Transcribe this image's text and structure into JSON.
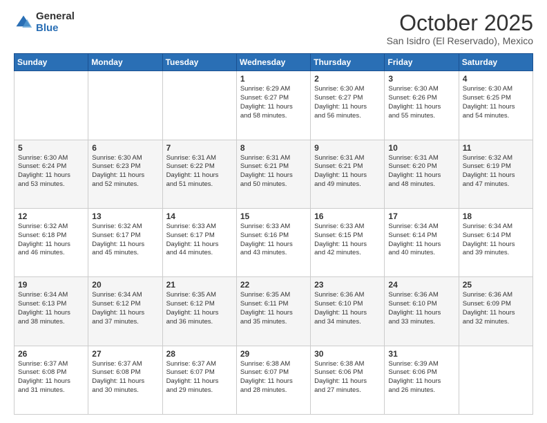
{
  "logo": {
    "general": "General",
    "blue": "Blue"
  },
  "header": {
    "month": "October 2025",
    "location": "San Isidro (El Reservado), Mexico"
  },
  "days_of_week": [
    "Sunday",
    "Monday",
    "Tuesday",
    "Wednesday",
    "Thursday",
    "Friday",
    "Saturday"
  ],
  "weeks": [
    [
      {
        "num": "",
        "info": ""
      },
      {
        "num": "",
        "info": ""
      },
      {
        "num": "",
        "info": ""
      },
      {
        "num": "1",
        "info": "Sunrise: 6:29 AM\nSunset: 6:27 PM\nDaylight: 11 hours\nand 58 minutes."
      },
      {
        "num": "2",
        "info": "Sunrise: 6:30 AM\nSunset: 6:27 PM\nDaylight: 11 hours\nand 56 minutes."
      },
      {
        "num": "3",
        "info": "Sunrise: 6:30 AM\nSunset: 6:26 PM\nDaylight: 11 hours\nand 55 minutes."
      },
      {
        "num": "4",
        "info": "Sunrise: 6:30 AM\nSunset: 6:25 PM\nDaylight: 11 hours\nand 54 minutes."
      }
    ],
    [
      {
        "num": "5",
        "info": "Sunrise: 6:30 AM\nSunset: 6:24 PM\nDaylight: 11 hours\nand 53 minutes."
      },
      {
        "num": "6",
        "info": "Sunrise: 6:30 AM\nSunset: 6:23 PM\nDaylight: 11 hours\nand 52 minutes."
      },
      {
        "num": "7",
        "info": "Sunrise: 6:31 AM\nSunset: 6:22 PM\nDaylight: 11 hours\nand 51 minutes."
      },
      {
        "num": "8",
        "info": "Sunrise: 6:31 AM\nSunset: 6:21 PM\nDaylight: 11 hours\nand 50 minutes."
      },
      {
        "num": "9",
        "info": "Sunrise: 6:31 AM\nSunset: 6:21 PM\nDaylight: 11 hours\nand 49 minutes."
      },
      {
        "num": "10",
        "info": "Sunrise: 6:31 AM\nSunset: 6:20 PM\nDaylight: 11 hours\nand 48 minutes."
      },
      {
        "num": "11",
        "info": "Sunrise: 6:32 AM\nSunset: 6:19 PM\nDaylight: 11 hours\nand 47 minutes."
      }
    ],
    [
      {
        "num": "12",
        "info": "Sunrise: 6:32 AM\nSunset: 6:18 PM\nDaylight: 11 hours\nand 46 minutes."
      },
      {
        "num": "13",
        "info": "Sunrise: 6:32 AM\nSunset: 6:17 PM\nDaylight: 11 hours\nand 45 minutes."
      },
      {
        "num": "14",
        "info": "Sunrise: 6:33 AM\nSunset: 6:17 PM\nDaylight: 11 hours\nand 44 minutes."
      },
      {
        "num": "15",
        "info": "Sunrise: 6:33 AM\nSunset: 6:16 PM\nDaylight: 11 hours\nand 43 minutes."
      },
      {
        "num": "16",
        "info": "Sunrise: 6:33 AM\nSunset: 6:15 PM\nDaylight: 11 hours\nand 42 minutes."
      },
      {
        "num": "17",
        "info": "Sunrise: 6:34 AM\nSunset: 6:14 PM\nDaylight: 11 hours\nand 40 minutes."
      },
      {
        "num": "18",
        "info": "Sunrise: 6:34 AM\nSunset: 6:14 PM\nDaylight: 11 hours\nand 39 minutes."
      }
    ],
    [
      {
        "num": "19",
        "info": "Sunrise: 6:34 AM\nSunset: 6:13 PM\nDaylight: 11 hours\nand 38 minutes."
      },
      {
        "num": "20",
        "info": "Sunrise: 6:34 AM\nSunset: 6:12 PM\nDaylight: 11 hours\nand 37 minutes."
      },
      {
        "num": "21",
        "info": "Sunrise: 6:35 AM\nSunset: 6:12 PM\nDaylight: 11 hours\nand 36 minutes."
      },
      {
        "num": "22",
        "info": "Sunrise: 6:35 AM\nSunset: 6:11 PM\nDaylight: 11 hours\nand 35 minutes."
      },
      {
        "num": "23",
        "info": "Sunrise: 6:36 AM\nSunset: 6:10 PM\nDaylight: 11 hours\nand 34 minutes."
      },
      {
        "num": "24",
        "info": "Sunrise: 6:36 AM\nSunset: 6:10 PM\nDaylight: 11 hours\nand 33 minutes."
      },
      {
        "num": "25",
        "info": "Sunrise: 6:36 AM\nSunset: 6:09 PM\nDaylight: 11 hours\nand 32 minutes."
      }
    ],
    [
      {
        "num": "26",
        "info": "Sunrise: 6:37 AM\nSunset: 6:08 PM\nDaylight: 11 hours\nand 31 minutes."
      },
      {
        "num": "27",
        "info": "Sunrise: 6:37 AM\nSunset: 6:08 PM\nDaylight: 11 hours\nand 30 minutes."
      },
      {
        "num": "28",
        "info": "Sunrise: 6:37 AM\nSunset: 6:07 PM\nDaylight: 11 hours\nand 29 minutes."
      },
      {
        "num": "29",
        "info": "Sunrise: 6:38 AM\nSunset: 6:07 PM\nDaylight: 11 hours\nand 28 minutes."
      },
      {
        "num": "30",
        "info": "Sunrise: 6:38 AM\nSunset: 6:06 PM\nDaylight: 11 hours\nand 27 minutes."
      },
      {
        "num": "31",
        "info": "Sunrise: 6:39 AM\nSunset: 6:06 PM\nDaylight: 11 hours\nand 26 minutes."
      },
      {
        "num": "",
        "info": ""
      }
    ]
  ]
}
